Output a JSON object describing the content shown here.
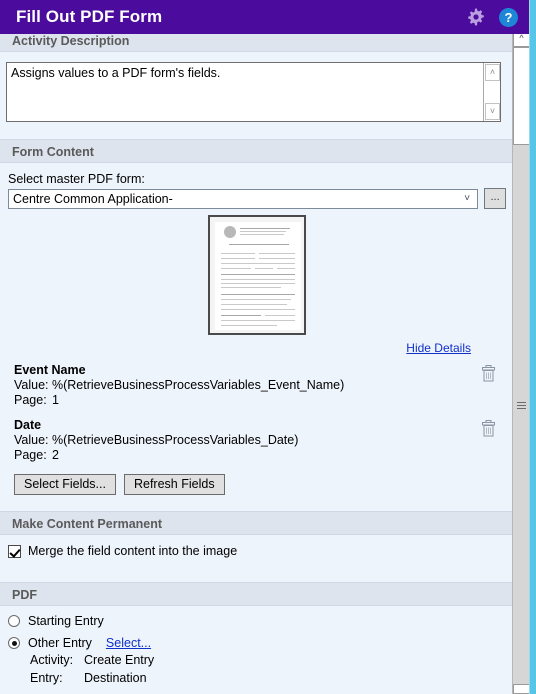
{
  "window": {
    "title": "Fill Out PDF Form",
    "gear_icon": "gear-icon",
    "help_icon": "?",
    "accent_color": "#4b0c9e",
    "help_color": "#1e86d6",
    "edge_color": "#55c5e8",
    "link_color": "#1130c8"
  },
  "activity_description": {
    "heading": "Activity Description",
    "text": "Assigns values to a PDF form's fields.",
    "scroll_up": "˄",
    "scroll_down": "˅"
  },
  "form_content": {
    "heading": "Form Content",
    "select_label": "Select master PDF form:",
    "selected_form": "Centre Common Application-",
    "dropdown_arrow": "˅",
    "browse_label": "...",
    "hide_details": "Hide Details",
    "fields": [
      {
        "name": "Event Name",
        "value_label": "Value:",
        "value": "%(RetrieveBusinessProcessVariables_Event_Name)",
        "page_label": "Page:",
        "page": "1",
        "delete_icon": "trash-icon"
      },
      {
        "name": "Date",
        "value_label": "Value:",
        "value": "%(RetrieveBusinessProcessVariables_Date)",
        "page_label": "Page:",
        "page": "2",
        "delete_icon": "trash-icon"
      }
    ],
    "select_fields_button": "Select Fields...",
    "refresh_fields_button": "Refresh Fields"
  },
  "make_content_permanent": {
    "heading": "Make Content Permanent",
    "merge_checkbox_label": "Merge the field content into the image",
    "merge_checked": true
  },
  "pdf": {
    "heading": "PDF",
    "starting_entry_label": "Starting Entry",
    "starting_entry_selected": false,
    "other_entry_label": "Other Entry",
    "other_entry_selected": true,
    "select_link": "Select...",
    "activity_label": "Activity:",
    "activity_value": "Create Entry",
    "entry_label": "Entry:",
    "entry_value": "Destination"
  }
}
